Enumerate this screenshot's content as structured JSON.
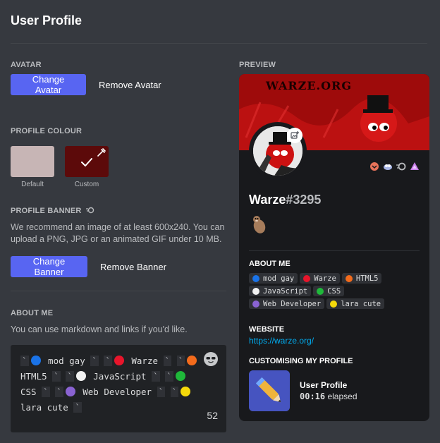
{
  "page": {
    "title": "User Profile"
  },
  "avatar": {
    "label": "AVATAR",
    "change_label": "Change Avatar",
    "remove_label": "Remove Avatar"
  },
  "profile_colour": {
    "label": "PROFILE COLOUR",
    "default_caption": "Default",
    "custom_caption": "Custom",
    "default_color": "#c7b5b5",
    "custom_color": "#5c0a0a"
  },
  "profile_banner": {
    "label": "PROFILE BANNER",
    "desc_line1": "We recommend an image of at least 600x240. You can",
    "desc_line2": "upload a PNG, JPG or an animated GIF under 10 MB.",
    "change_label": "Change Banner",
    "remove_label": "Remove Banner"
  },
  "about_me": {
    "label": "ABOUT ME",
    "description": "You can use markdown and links if you'd like.",
    "remaining_chars": "52",
    "entries": [
      {
        "text": "mod gay",
        "color": "#1a73e8"
      },
      {
        "text": "Warze",
        "color": "#e8152b"
      },
      {
        "text": "HTML5",
        "color": "#f36b1c"
      },
      {
        "text": "JavaScript",
        "color": "#f2f2f2"
      },
      {
        "text": "CSS",
        "color": "#1fb83a"
      },
      {
        "text": "Web Developer",
        "color": "#8a63d2"
      },
      {
        "text": "lara cute",
        "color": "#f5d90a"
      }
    ]
  },
  "preview": {
    "label": "PREVIEW",
    "banner_text": "WARZE.ORG",
    "username": "Warze",
    "discriminator": "#3295",
    "about_me_label": "ABOUT ME",
    "website_label": "WEBSITE",
    "website_url": "https://warze.org/",
    "customising_label": "CUSTOMISING MY PROFILE",
    "activity_name": "User Profile",
    "activity_time": "00:16",
    "activity_suffix": "elapsed"
  }
}
